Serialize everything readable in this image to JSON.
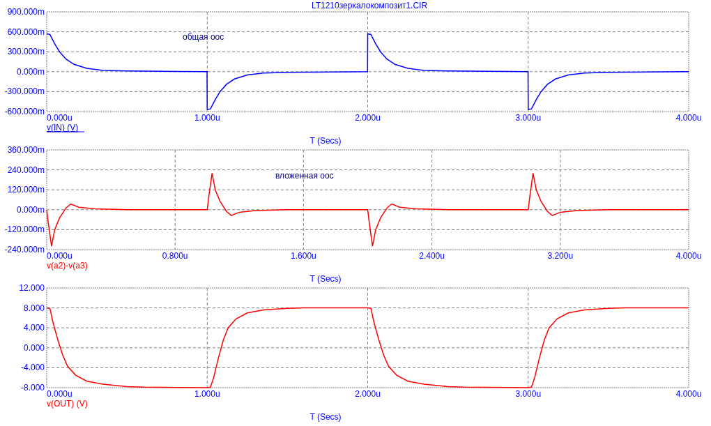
{
  "title": "LT1210зеркалокомпозит1.CIR",
  "plots": [
    {
      "selected": true,
      "note": "общая оос",
      "chart_data": {
        "type": "line",
        "xlabel": "T (Secs)",
        "grid": true,
        "xlim": [
          0,
          4
        ],
        "ylim": [
          -600,
          900
        ],
        "x": [
          0,
          0.02,
          0.05,
          0.08,
          0.12,
          0.17,
          0.25,
          0.35,
          0.5,
          0.999,
          1,
          1.02,
          1.05,
          1.08,
          1.12,
          1.17,
          1.25,
          1.35,
          1.5,
          1.999,
          2,
          2.02,
          2.05,
          2.08,
          2.12,
          2.17,
          2.25,
          2.35,
          2.5,
          2.999,
          3,
          3.02,
          3.05,
          3.08,
          3.12,
          3.17,
          3.25,
          3.35,
          3.5,
          4
        ],
        "xticks": [
          {
            "value": 0,
            "label": "0.000u"
          },
          {
            "value": 1,
            "label": "1.000u"
          },
          {
            "value": 2,
            "label": "2.000u"
          },
          {
            "value": 3,
            "label": "3.000u"
          },
          {
            "value": 4,
            "label": "4.000u"
          }
        ],
        "yticks": [
          {
            "value": -600,
            "label": "-600.000m"
          },
          {
            "value": -300,
            "label": "-300.000m"
          },
          {
            "value": 0,
            "label": "0.000m"
          },
          {
            "value": 300,
            "label": "300.000m"
          },
          {
            "value": 600,
            "label": "600.000m"
          },
          {
            "value": 900,
            "label": "900.000m"
          }
        ],
        "series": [
          {
            "name": "v(IN) (V)",
            "color": "#0000ff",
            "values": [
              570,
              560,
              420,
              300,
              190,
              110,
              50,
              20,
              10,
              0,
              -570,
              -560,
              -420,
              -300,
              -190,
              -110,
              -50,
              -20,
              -10,
              0,
              570,
              560,
              420,
              300,
              190,
              110,
              50,
              20,
              10,
              0,
              -570,
              -560,
              -420,
              -300,
              -190,
              -110,
              -50,
              -20,
              -10,
              0
            ]
          }
        ]
      }
    },
    {
      "selected": false,
      "note": "вложенная оос",
      "chart_data": {
        "type": "line",
        "xlabel": "T (Secs)",
        "grid": true,
        "xlim": [
          0,
          4
        ],
        "ylim": [
          -240,
          360
        ],
        "x": [
          0,
          0.01,
          0.03,
          0.05,
          0.08,
          0.12,
          0.15,
          0.2,
          0.3,
          0.5,
          0.999,
          1,
          1.01,
          1.03,
          1.05,
          1.08,
          1.12,
          1.15,
          1.2,
          1.3,
          1.5,
          1.999,
          2,
          2.01,
          2.03,
          2.05,
          2.08,
          2.12,
          2.15,
          2.2,
          2.3,
          2.5,
          2.999,
          3,
          3.01,
          3.03,
          3.05,
          3.08,
          3.12,
          3.15,
          3.2,
          3.3,
          3.5,
          4
        ],
        "xticks": [
          {
            "value": 0,
            "label": "0.000u"
          },
          {
            "value": 0.8,
            "label": "0.800u"
          },
          {
            "value": 1.6,
            "label": "1.600u"
          },
          {
            "value": 2.4,
            "label": "2.400u"
          },
          {
            "value": 3.2,
            "label": "3.200u"
          },
          {
            "value": 4,
            "label": "4.000u"
          }
        ],
        "yticks": [
          {
            "value": -240,
            "label": "-240.000m"
          },
          {
            "value": -120,
            "label": "-120.000m"
          },
          {
            "value": 0,
            "label": "0.000m"
          },
          {
            "value": 120,
            "label": "120.000m"
          },
          {
            "value": 240,
            "label": "240.000m"
          },
          {
            "value": 360,
            "label": "360.000m"
          }
        ],
        "series": [
          {
            "name": "v(a2)-v(a3)",
            "color": "#ff0000",
            "values": [
              0,
              -80,
              -220,
              -120,
              -50,
              10,
              35,
              15,
              5,
              0,
              0,
              0,
              80,
              220,
              120,
              50,
              -10,
              -35,
              -15,
              -5,
              0,
              0,
              0,
              -80,
              -220,
              -120,
              -50,
              10,
              35,
              15,
              5,
              0,
              0,
              0,
              80,
              220,
              120,
              50,
              -10,
              -35,
              -15,
              -5,
              0,
              0
            ]
          }
        ]
      }
    },
    {
      "selected": false,
      "chart_data": {
        "type": "line",
        "xlabel": "T (Secs)",
        "grid": true,
        "xlim": [
          0,
          4
        ],
        "ylim": [
          -8,
          12
        ],
        "x": [
          0,
          0.02,
          0.04,
          0.07,
          0.1,
          0.13,
          0.18,
          0.25,
          0.35,
          0.5,
          0.6,
          0.999,
          1,
          1.02,
          1.04,
          1.07,
          1.1,
          1.13,
          1.18,
          1.25,
          1.35,
          1.5,
          1.6,
          1.999,
          2,
          2.02,
          2.04,
          2.07,
          2.1,
          2.13,
          2.18,
          2.25,
          2.35,
          2.5,
          2.6,
          2.999,
          3,
          3.02,
          3.04,
          3.07,
          3.1,
          3.13,
          3.18,
          3.25,
          3.35,
          3.5,
          3.6,
          4
        ],
        "xticks": [
          {
            "value": 0,
            "label": "0.000u"
          },
          {
            "value": 1,
            "label": "1.000u"
          },
          {
            "value": 2,
            "label": "2.000u"
          },
          {
            "value": 3,
            "label": "3.000u"
          },
          {
            "value": 4,
            "label": "4.000u"
          }
        ],
        "yticks": [
          {
            "value": -8,
            "label": "-8.000"
          },
          {
            "value": -4,
            "label": "-4.000"
          },
          {
            "value": 0,
            "label": "0.000"
          },
          {
            "value": 4,
            "label": "4.000"
          },
          {
            "value": 8,
            "label": "8.000"
          },
          {
            "value": 12,
            "label": "12.000"
          }
        ],
        "series": [
          {
            "name": "v(OUT) (V)",
            "color": "#ff0000",
            "values": [
              8,
              7.9,
              5,
              1.5,
              -1.5,
              -3.7,
              -5.5,
              -6.7,
              -7.3,
              -7.8,
              -7.9,
              -8,
              -8,
              -7.9,
              -6,
              -2,
              1.5,
              4,
              5.8,
              7,
              7.6,
              7.9,
              8,
              8,
              8,
              7.9,
              5,
              1.5,
              -1.5,
              -3.7,
              -5.5,
              -6.7,
              -7.3,
              -7.8,
              -7.9,
              -8,
              -8,
              -7.9,
              -6,
              -2,
              1.5,
              4,
              5.8,
              7,
              7.6,
              7.9,
              8,
              8
            ]
          }
        ]
      }
    }
  ]
}
